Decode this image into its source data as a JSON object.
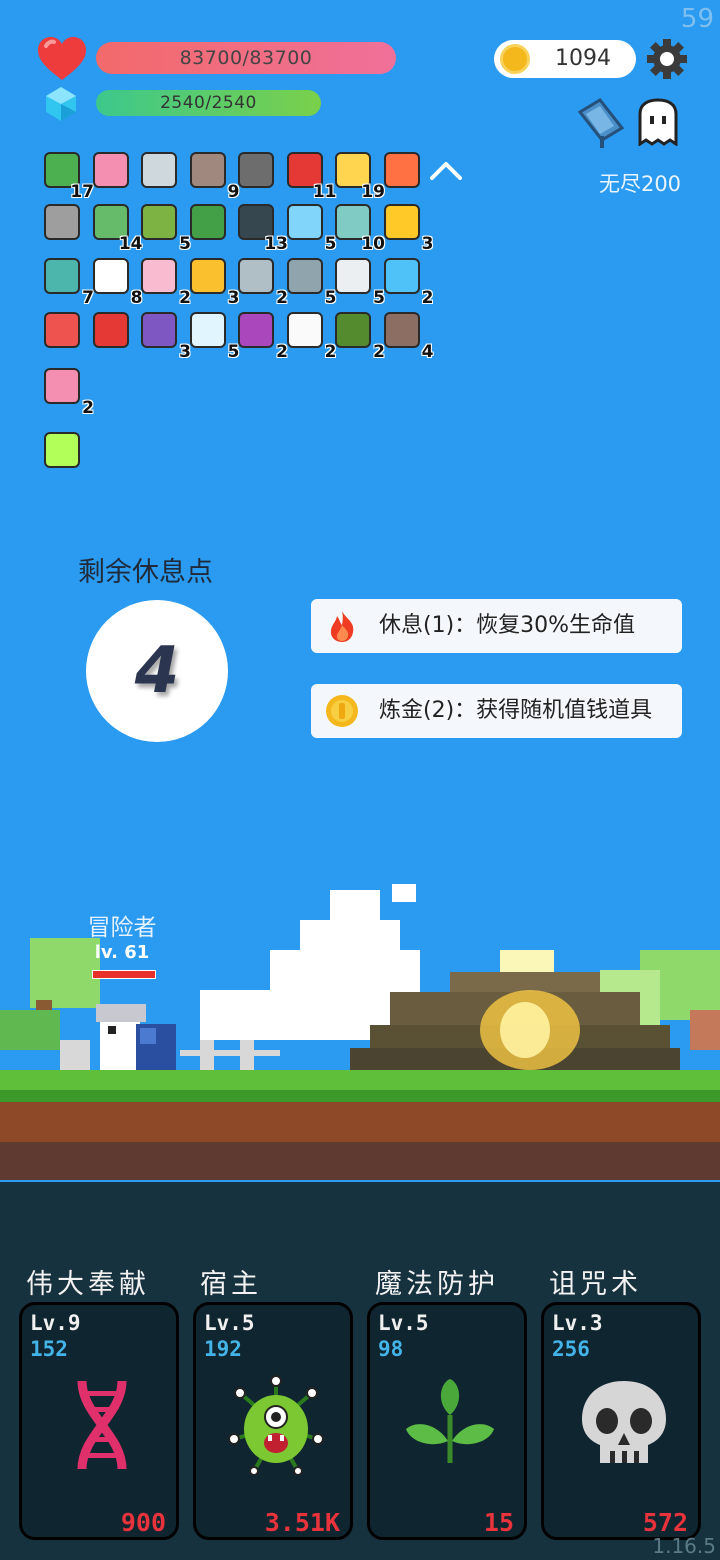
{
  "fps": "59",
  "version": "1.16.5",
  "hud": {
    "hp": "83700/83700",
    "mp": "2540/2540",
    "gold": "1094",
    "mode": "无尽200"
  },
  "inventory": [
    {
      "icon": "cash-heart-icon",
      "count": "17"
    },
    {
      "icon": "love-letter-icon",
      "count": ""
    },
    {
      "icon": "sword-icon",
      "count": ""
    },
    {
      "icon": "tombstone-icon",
      "count": "9"
    },
    {
      "icon": "mortar-icon",
      "count": ""
    },
    {
      "icon": "mushroom-icon",
      "count": "11"
    },
    {
      "icon": "sun-bulb-icon",
      "count": "19"
    },
    {
      "icon": "torch-icon",
      "count": ""
    },
    {
      "icon": "knight-helmet-icon",
      "count": ""
    },
    {
      "icon": "turtle-shell-icon",
      "count": "14"
    },
    {
      "icon": "green-monster-icon",
      "count": "5"
    },
    {
      "icon": "green-card-icon",
      "count": ""
    },
    {
      "icon": "bat-icon",
      "count": "13"
    },
    {
      "icon": "potion-flask-icon",
      "count": "5"
    },
    {
      "icon": "disc-icon",
      "count": "10"
    },
    {
      "icon": "magic-wand-icon",
      "count": "3"
    },
    {
      "icon": "green-idol-icon",
      "count": "7"
    },
    {
      "icon": "ghost-icon",
      "count": "8"
    },
    {
      "icon": "ice-cream-icon",
      "count": "2"
    },
    {
      "icon": "crown-icon",
      "count": "3"
    },
    {
      "icon": "battle-axe-icon",
      "count": "2"
    },
    {
      "icon": "compass-icon",
      "count": "5"
    },
    {
      "icon": "dice-icon",
      "count": "5"
    },
    {
      "icon": "crosshair-icon",
      "count": "2"
    },
    {
      "icon": "pill-icon",
      "count": ""
    },
    {
      "icon": "gift-box-icon",
      "count": ""
    },
    {
      "icon": "purple-chest-icon",
      "count": "3"
    },
    {
      "icon": "light-bulb-icon",
      "count": "5"
    },
    {
      "icon": "crystal-ball-icon",
      "count": "2"
    },
    {
      "icon": "playing-cards-icon",
      "count": "2"
    },
    {
      "icon": "grenade-icon",
      "count": "2"
    },
    {
      "icon": "wooden-shield-icon",
      "count": "4"
    },
    {
      "icon": "spray-bottle-icon",
      "count": "2"
    },
    {
      "icon": "glowing-tile-icon",
      "count": ""
    }
  ],
  "rest": {
    "title": "剩余休息点",
    "points": "4",
    "options": [
      {
        "icon": "fire-icon",
        "label": "休息(1)：恢复30%生命值"
      },
      {
        "icon": "coin-icon",
        "label": "炼金(2)：获得随机值钱道具"
      }
    ]
  },
  "hero": {
    "name": "冒险者",
    "level": "lv. 61"
  },
  "skills": [
    {
      "name": "伟大奉献",
      "level": "Lv.9",
      "points": "152",
      "cost": "900",
      "icon": "dna-icon"
    },
    {
      "name": "宿主",
      "level": "Lv.5",
      "points": "192",
      "cost": "3.51K",
      "icon": "virus-monster-icon"
    },
    {
      "name": "魔法防护",
      "level": "Lv.5",
      "points": "98",
      "cost": "15",
      "icon": "leaf-sprout-icon"
    },
    {
      "name": "诅咒术",
      "level": "Lv.3",
      "points": "256",
      "cost": "572",
      "icon": "skull-icon"
    }
  ]
}
